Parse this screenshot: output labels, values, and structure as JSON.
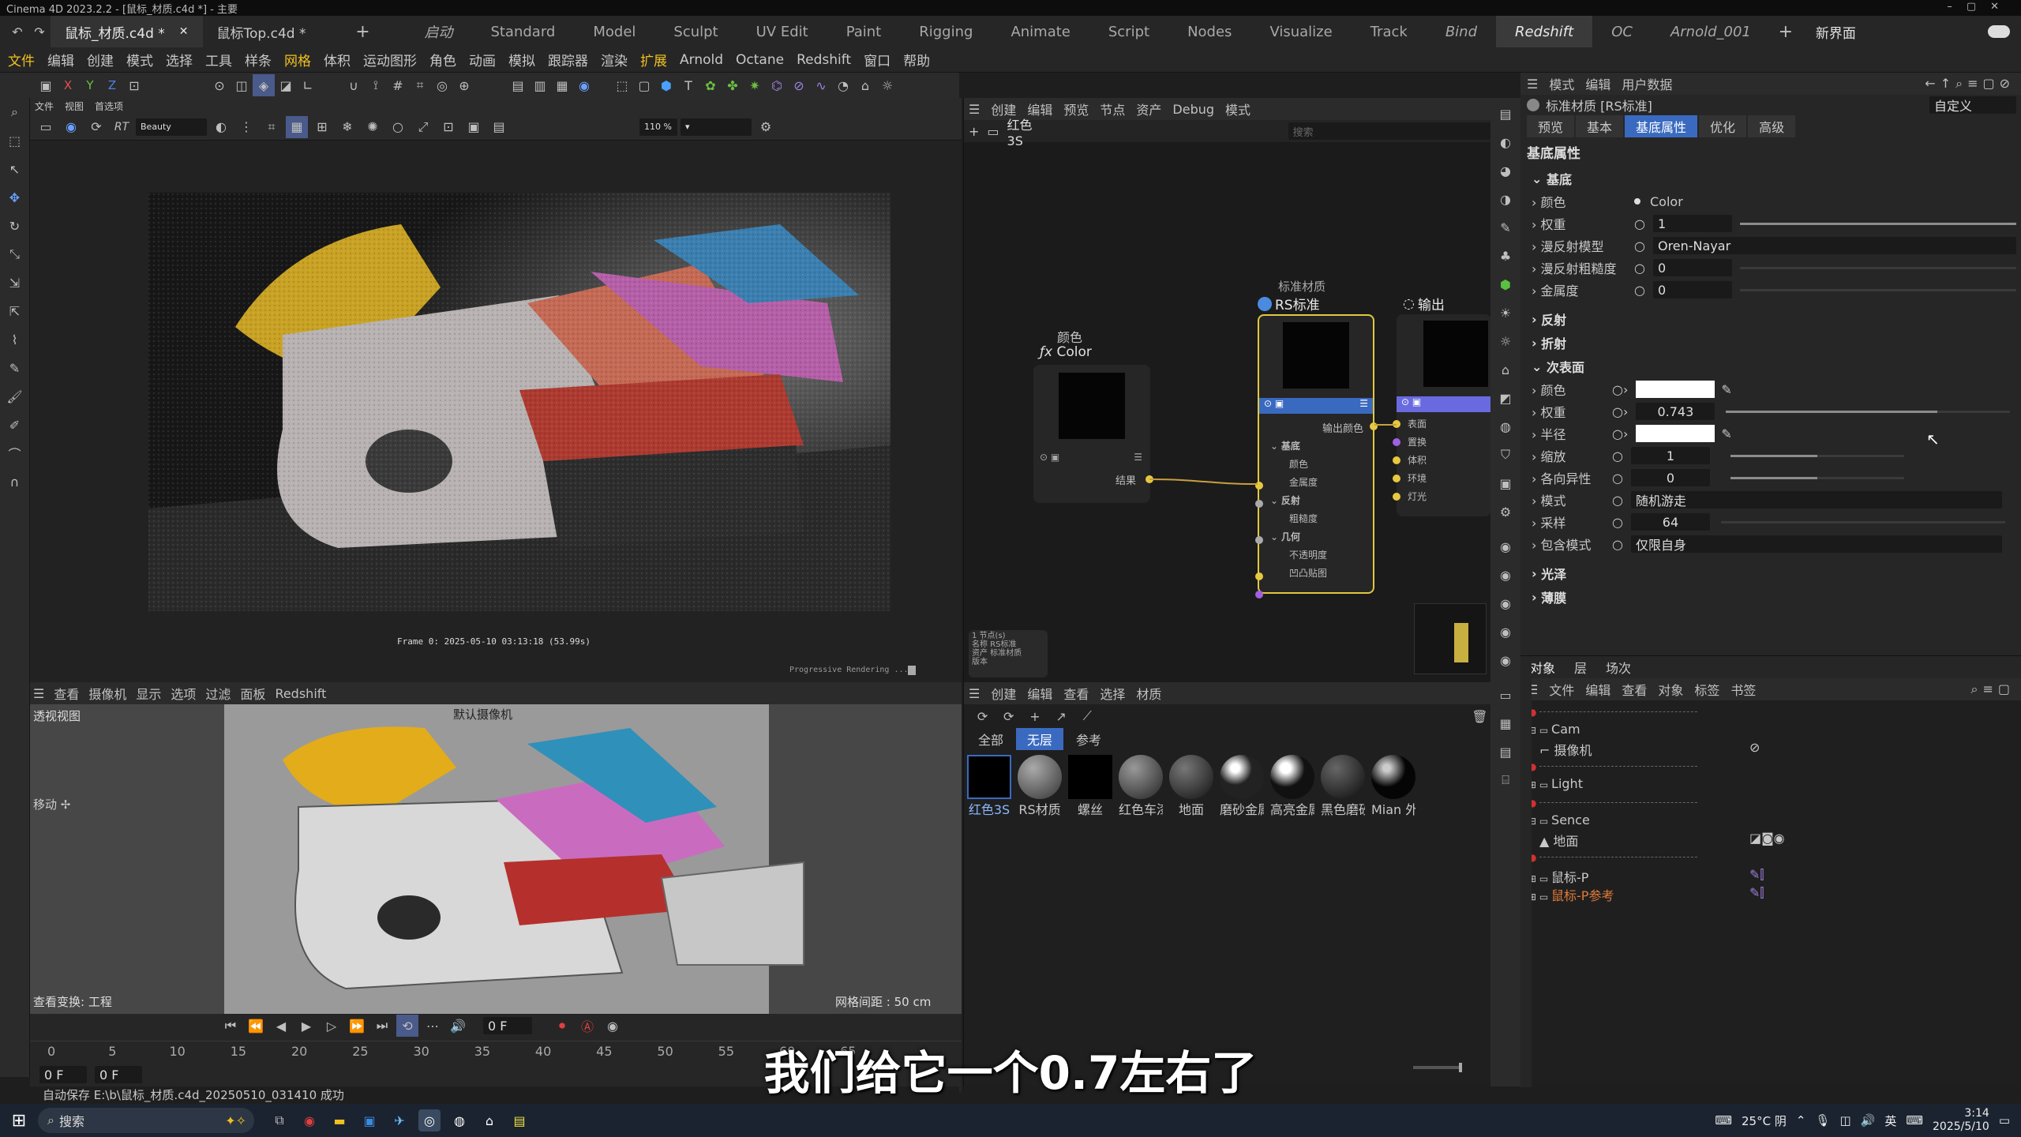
{
  "window": {
    "title": "Cinema 4D 2023.2.2 - [鼠标_材质.c4d *] - 主要"
  },
  "doc_tabs": [
    {
      "label": "鼠标_材质.c4d *",
      "active": true
    },
    {
      "label": "鼠标Top.c4d *",
      "active": false
    }
  ],
  "layout_tabs": [
    "启动",
    "Standard",
    "Model",
    "Sculpt",
    "UV Edit",
    "Paint",
    "Rigging",
    "Animate",
    "Script",
    "Nodes",
    "Visualize",
    "Track",
    "Bind",
    "Redshift",
    "OC",
    "Arnold_001"
  ],
  "layout_active": "Redshift",
  "new_layout": "新界面",
  "menu": [
    "文件",
    "编辑",
    "创建",
    "模式",
    "选择",
    "工具",
    "样条",
    "网格",
    "体积",
    "运动图形",
    "角色",
    "动画",
    "模拟",
    "跟踪器",
    "渲染",
    "扩展",
    "Arnold",
    "Octane",
    "Redshift",
    "窗口",
    "帮助"
  ],
  "toolbar_axes": [
    "X",
    "Y",
    "Z"
  ],
  "rs_viewer": {
    "menu": [
      "文件",
      "视图",
      "首选项"
    ],
    "frame_info": "Frame  0:  2025-05-10  03:13:18  (53.99s)",
    "progress": "Progressive Rendering ...",
    "zoom": "110 %",
    "mode": "Beauty"
  },
  "viewport": {
    "menu": [
      "查看",
      "摄像机",
      "显示",
      "选项",
      "过滤",
      "面板",
      "Redshift"
    ],
    "label": "透视视图",
    "camera": "默认摄像机",
    "move_label": "移动 ✢",
    "view_transform": "查看变换: 工程",
    "grid_spacing": "网格间距 : 50 cm"
  },
  "timeline": {
    "frame": "0 F",
    "ticks": [
      "0",
      "5",
      "10",
      "15",
      "20",
      "25",
      "30",
      "35",
      "40",
      "45",
      "50",
      "55",
      "60",
      "65"
    ],
    "start": "0 F",
    "end": "0 F",
    "status": "自动保存 E:\\b\\鼠标_材质.c4d_20250510_031410 成功"
  },
  "node_editor": {
    "menu": [
      "创建",
      "编辑",
      "预览",
      "节点",
      "资产",
      "Debug",
      "模式"
    ],
    "material_name": "红色3S",
    "search_placeholder": "搜索",
    "color_node": {
      "category": "颜色",
      "title": "Color",
      "port": "结果"
    },
    "rs_node": {
      "category": "标准材质",
      "title": "RS标准",
      "out_port": "输出颜色",
      "groups": [
        "基底",
        "颜色",
        "金属度",
        "反射",
        "粗糙度",
        "几何",
        "不透明度",
        "凹凸贴图"
      ]
    },
    "output_node": {
      "title": "输出",
      "ports": [
        "表面",
        "置换",
        "体积",
        "环境",
        "灯光"
      ]
    },
    "info": [
      "1 节点(s)",
      "名称  RS标准",
      "资产  标准材质",
      "版本"
    ]
  },
  "material_manager": {
    "menu": [
      "创建",
      "编辑",
      "查看",
      "选择",
      "材质"
    ],
    "filters": [
      "全部",
      "无层",
      "参考"
    ],
    "active_filter": "无层",
    "materials": [
      "红色3S",
      "RS材质",
      "螺丝",
      "红色车漆",
      "地面",
      "磨砂金属",
      "高亮金属",
      "黑色磨砂",
      "Mian 外"
    ]
  },
  "attributes": {
    "menu": [
      "模式",
      "编辑",
      "用户数据"
    ],
    "title": "标准材质 [RS标准]",
    "preset": "自定义",
    "tabs": [
      "预览",
      "基本",
      "基底属性",
      "优化",
      "高级"
    ],
    "active_tab": "基底属性",
    "section_title": "基底属性",
    "base": {
      "label": "基底",
      "color_label": "颜色",
      "color_value": "Color",
      "weight_label": "权重",
      "weight_value": "1",
      "weight_fill": 1.0,
      "model_label": "漫反射模型",
      "model_value": "Oren-Nayar",
      "rough_label": "漫反射粗糙度",
      "rough_value": "0",
      "rough_fill": 0.0,
      "metal_label": "金属度",
      "metal_value": "0",
      "metal_fill": 0.0
    },
    "collapsed": [
      "反射",
      "折射"
    ],
    "sss": {
      "label": "次表面",
      "color_label": "颜色",
      "weight_label": "权重",
      "weight_value": "0.743",
      "weight_fill": 0.743,
      "radius_label": "半径",
      "scale_label": "缩放",
      "scale_value": "1",
      "scale_fill": 0.5,
      "aniso_label": "各向异性",
      "aniso_value": "0",
      "aniso_fill": 0.5,
      "mode_label": "模式",
      "mode_value": "随机游走",
      "samples_label": "采样",
      "samples_value": "64",
      "samples_fill": 0.0,
      "include_label": "包含模式",
      "include_value": "仅限自身"
    },
    "collapsed_after": [
      "光泽",
      "薄膜"
    ]
  },
  "objects": {
    "tabs": [
      "对象",
      "层",
      "场次"
    ],
    "menu": [
      "文件",
      "编辑",
      "查看",
      "对象",
      "标签",
      "书签"
    ],
    "rows": [
      {
        "name": "Cam",
        "indent": 0,
        "color": "#c8c8c8"
      },
      {
        "name": "摄像机",
        "indent": 1,
        "color": "#c8c8c8"
      },
      {
        "name": "Light",
        "indent": 0,
        "color": "#c8c8c8"
      },
      {
        "name": "Sence",
        "indent": 0,
        "color": "#c8c8c8"
      },
      {
        "name": "地面",
        "indent": 1,
        "color": "#c8c8c8"
      },
      {
        "name": "鼠标-P",
        "indent": 0,
        "color": "#c8c8c8"
      },
      {
        "name": "鼠标-P参考",
        "indent": 0,
        "color": "#e07a3a"
      }
    ]
  },
  "subtitle": "我们给它一个0.7左右了",
  "taskbar": {
    "search": "搜索",
    "weather": "25°C 阴",
    "ime": "英",
    "time": "3:14",
    "date": "2025/5/10"
  }
}
